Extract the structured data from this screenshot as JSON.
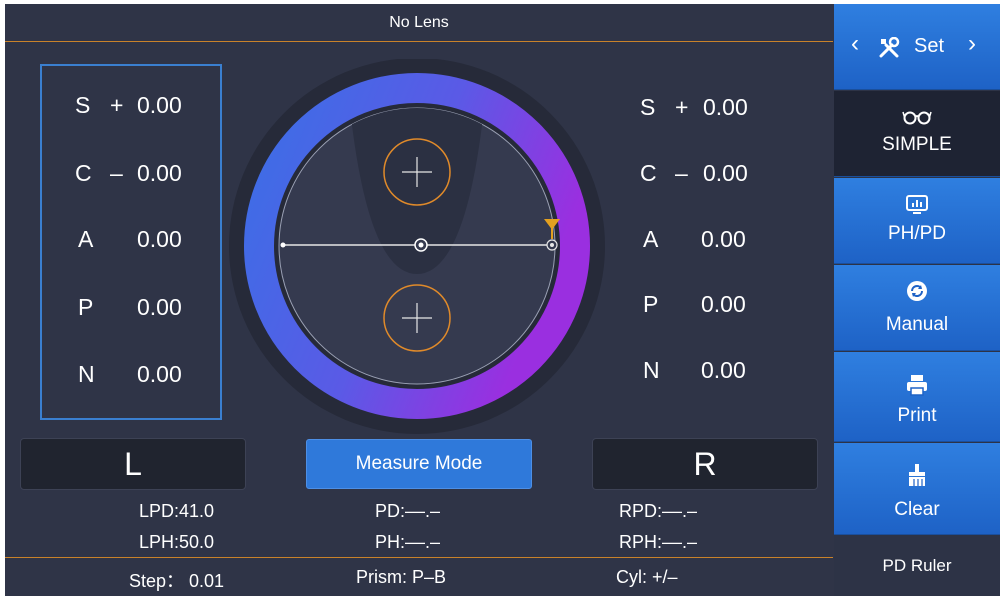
{
  "title": "No Lens",
  "left": {
    "rows": [
      {
        "key": "S",
        "sign": "+",
        "value": "0.00"
      },
      {
        "key": "C",
        "sign": "–",
        "value": "0.00"
      },
      {
        "key": "A",
        "sign": "",
        "value": "0.00"
      },
      {
        "key": "P",
        "sign": "",
        "value": "0.00"
      },
      {
        "key": "N",
        "sign": "",
        "value": "0.00"
      }
    ],
    "button_label": "L"
  },
  "right": {
    "rows": [
      {
        "key": "S",
        "sign": "+",
        "value": "0.00"
      },
      {
        "key": "C",
        "sign": "–",
        "value": "0.00"
      },
      {
        "key": "A",
        "sign": "",
        "value": "0.00"
      },
      {
        "key": "P",
        "sign": "",
        "value": "0.00"
      },
      {
        "key": "N",
        "sign": "",
        "value": "0.00"
      }
    ],
    "button_label": "R"
  },
  "measure_mode_label": "Measure Mode",
  "info": {
    "lpd": "LPD:41.0",
    "lph": "LPH:50.0",
    "pd": "PD:––.–",
    "ph": "PH:––.–",
    "rpd": "RPD:––.–",
    "rph": "RPH:––.–"
  },
  "bottom": {
    "step": "Step： 0.01",
    "prism": "Prism:  P–B",
    "cyl": "Cyl:  +/–"
  },
  "sidebar": {
    "set_label": "Set",
    "prev_arrow": "‹",
    "next_arrow": "›",
    "items": [
      {
        "label": "SIMPLE",
        "icon": "glasses-icon"
      },
      {
        "label": "PH/PD",
        "icon": "monitor-chart-icon"
      },
      {
        "label": "Manual",
        "icon": "refresh-icon"
      },
      {
        "label": "Print",
        "icon": "printer-icon"
      },
      {
        "label": "Clear",
        "icon": "brush-icon"
      }
    ],
    "pd_ruler": "PD  Ruler"
  },
  "colors": {
    "accent": "#2f79da",
    "background": "#2f3447",
    "divider": "#c9822a",
    "ring_start": "#3b6fe6",
    "ring_end": "#9a2fe0"
  }
}
